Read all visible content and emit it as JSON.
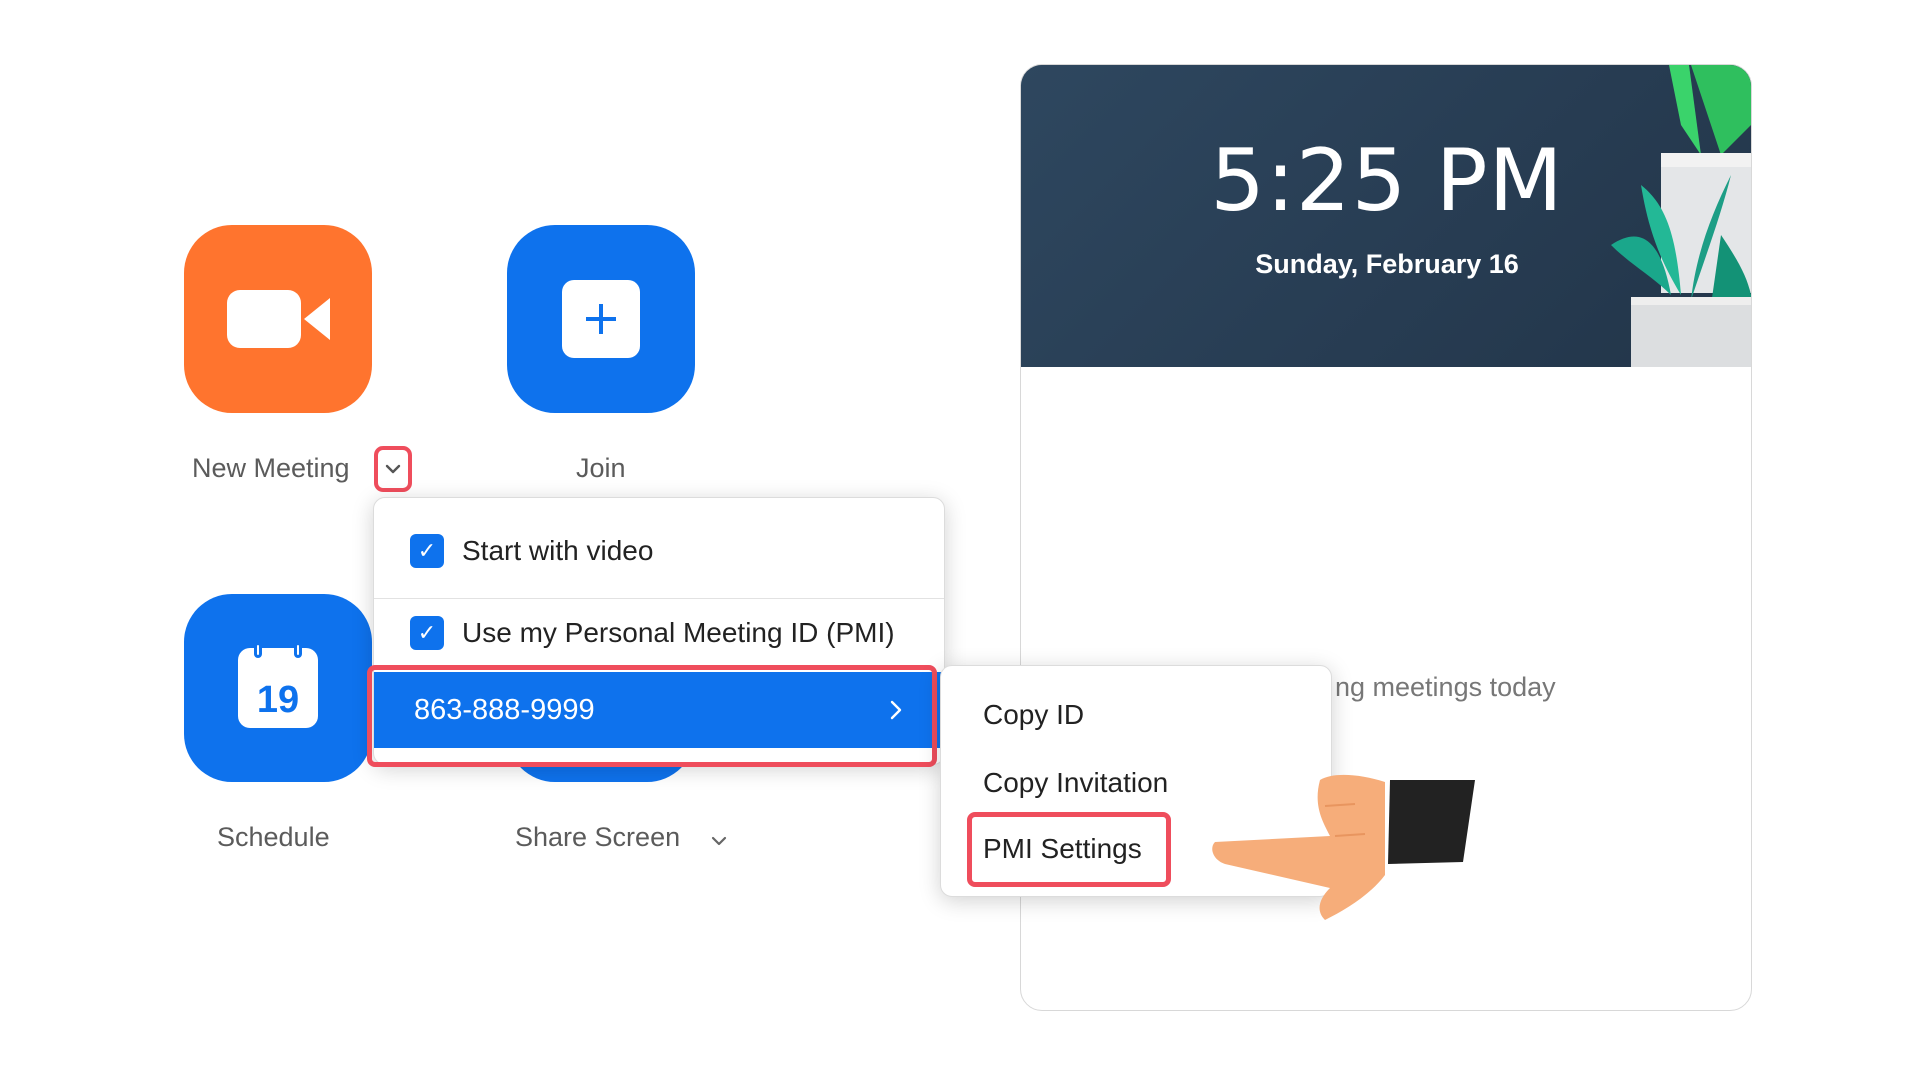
{
  "tiles": {
    "new_meeting": {
      "label": "New Meeting"
    },
    "join": {
      "label": "Join"
    },
    "schedule": {
      "label": "Schedule",
      "calendar_day": "19"
    },
    "share_screen": {
      "label": "Share Screen"
    }
  },
  "menu": {
    "start_with_video": {
      "label": "Start with video",
      "checked": true
    },
    "use_pmi": {
      "label": "Use my Personal Meeting ID (PMI)",
      "checked": true
    },
    "pmi_number": "863-888-9999"
  },
  "submenu": {
    "items": [
      "Copy ID",
      "Copy Invitation",
      "PMI Settings"
    ]
  },
  "panel": {
    "time": "5:25 PM",
    "date": "Sunday, February 16",
    "upcoming_text": "ng meetings today"
  },
  "colors": {
    "orange": "#ff742e",
    "blue": "#0e72ed",
    "highlight_red": "#ef4d5c",
    "header_bg": "#2b4158"
  },
  "icons": {
    "new_meeting": "video-camera-icon",
    "join": "plus-icon",
    "schedule": "calendar-icon",
    "dropdown": "chevron-down-icon",
    "submenu_arrow": "chevron-right-icon",
    "pointer": "pointing-hand-icon"
  }
}
